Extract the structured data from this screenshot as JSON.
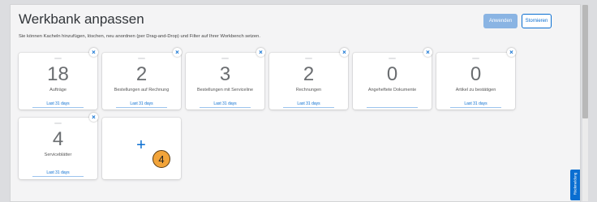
{
  "page": {
    "title": "Werkbank anpassen",
    "subtitle": "Sie können Kacheln hinzufügen, löschen, neu anordnen (per Drag-and-Drop) und Filter auf Ihrer Workbench setzen."
  },
  "toolbar": {
    "apply_label": "Anwenden",
    "cancel_label": "Stornieren"
  },
  "tiles": [
    {
      "value": "18",
      "label": "Aufträge",
      "filter": "Last 31 days"
    },
    {
      "value": "2",
      "label": "Bestellungen auf Rechnung",
      "filter": "Last 31 days"
    },
    {
      "value": "3",
      "label": "Bestellungen mit Serviceline",
      "filter": "Last 31 days"
    },
    {
      "value": "2",
      "label": "Rechnungen",
      "filter": "Last 31 days"
    },
    {
      "value": "0",
      "label": "Angeheftete Dokumente",
      "filter": ""
    },
    {
      "value": "0",
      "label": "Artikel zu bestätigen",
      "filter": "Last 31 days"
    },
    {
      "value": "4",
      "label": "Serviceblätter",
      "filter": "Last 31 days"
    }
  ],
  "close_glyph": "×",
  "add_tile": {
    "plus_glyph": "+",
    "callout_number": "4"
  },
  "feedback": {
    "label": "Rückmeldung"
  },
  "colors": {
    "accent": "#0a6ed1",
    "apply_button": "#8ab4e3",
    "callout": "#f2a43a"
  }
}
